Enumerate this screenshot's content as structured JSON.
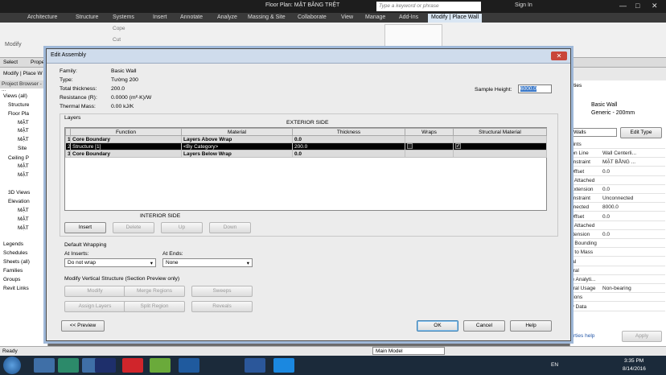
{
  "titlebar": {
    "document": "Floor Plan: MẶT BẰNG TRỆT",
    "search_placeholder": "Type a keyword or phrase",
    "sign_in": "Sign In"
  },
  "ribbon_tabs": [
    "Architecture",
    "Structure",
    "Systems",
    "Insert",
    "Annotate",
    "Analyze",
    "Massing & Site",
    "Collaborate",
    "View",
    "Manage",
    "Add-Ins",
    "Modify | Place Wall"
  ],
  "ribbon": {
    "modify": "Modify",
    "select": "Select",
    "properties": "Prope",
    "cope": "Cope",
    "cut": "Cut",
    "context": "Modify | Place W"
  },
  "project_browser": {
    "title": "Project Browser - ...",
    "items": [
      "Views (all)",
      "Structure",
      "Floor Pla",
      "MẶT",
      "MẶT",
      "MẶT",
      "Site",
      "Ceiling P",
      "MẶT",
      "MẶT",
      "3D Views",
      "Elevation",
      "MẶT",
      "MẶT",
      "MẶT",
      "Legends",
      "Schedules",
      "Sheets (all)",
      "Families",
      "Groups",
      "Revit Links"
    ]
  },
  "properties": {
    "header": "rties",
    "type_name": "Basic Wall",
    "type_sub": "Generic - 200mm",
    "walls": "Walls",
    "edit_type": "Edit Type",
    "rows": [
      {
        "k": "aints",
        "v": ""
      },
      {
        "k": "ion Line",
        "v": "Wall Centerli..."
      },
      {
        "k": "onstraint",
        "v": "MẶT BẰNG ..."
      },
      {
        "k": "Offset",
        "v": "0.0"
      },
      {
        "k": "s Attached",
        "v": ""
      },
      {
        "k": "Extension",
        "v": "0.0"
      },
      {
        "k": "onstraint",
        "v": "Unconnected"
      },
      {
        "k": "nnected",
        "v": "8000.0"
      },
      {
        "k": "Offset",
        "v": "0.0"
      },
      {
        "k": "s Attached",
        "v": ""
      },
      {
        "k": "xtension",
        "v": "0.0"
      },
      {
        "k": "n Bounding",
        "v": ""
      },
      {
        "k": "d to Mass",
        "v": ""
      },
      {
        "k": "ral",
        "v": ""
      },
      {
        "k": "ural",
        "v": ""
      },
      {
        "k": "le Analyti...",
        "v": ""
      },
      {
        "k": "ural Usage",
        "v": "Non-bearing"
      },
      {
        "k": "sions",
        "v": ""
      },
      {
        "k": "ly Data",
        "v": ""
      }
    ],
    "help": "rties help",
    "apply": "Apply"
  },
  "status": {
    "left": "Ready",
    "model": "Main Model"
  },
  "taskbar": {
    "lang": "EN",
    "time": "3:35 PM",
    "date": "8/14/2016"
  },
  "dialog": {
    "title": "Edit Assembly",
    "family_label": "Family:",
    "family": "Basic Wall",
    "type_label": "Type:",
    "type": "Tường 200",
    "thickness_label": "Total thickness:",
    "thickness": "200.0",
    "resistance_label": "Resistance (R):",
    "resistance": "0.0000 (m²·K)/W",
    "mass_label": "Thermal Mass:",
    "mass": "0.00 kJ/K",
    "sample_label": "Sample Height:",
    "sample": "6000.0",
    "layers_label": "Layers",
    "exterior": "EXTERIOR SIDE",
    "interior": "INTERIOR SIDE",
    "cols": [
      "Function",
      "Material",
      "Thickness",
      "Wraps",
      "Structural Material"
    ],
    "rows": [
      {
        "n": "1",
        "f": "Core Boundary",
        "m": "Layers Above Wrap",
        "t": "0.0"
      },
      {
        "n": "2",
        "f": "Structure [1]",
        "m": "<By Category>",
        "t": "200.0"
      },
      {
        "n": "3",
        "f": "Core Boundary",
        "m": "Layers Below Wrap",
        "t": "0.0"
      }
    ],
    "btn_insert": "Insert",
    "btn_delete": "Delete",
    "btn_up": "Up",
    "btn_down": "Down",
    "wrapping": "Default Wrapping",
    "at_inserts": "At Inserts:",
    "at_inserts_val": "Do not wrap",
    "at_ends": "At Ends:",
    "at_ends_val": "None",
    "vertical": "Modify Vertical Structure (Section Preview only)",
    "v_btns": [
      "Modify",
      "Merge Regions",
      "Sweeps",
      "Assign Layers",
      "Split Region",
      "Reveals"
    ],
    "preview": "<< Preview",
    "ok": "OK",
    "cancel": "Cancel",
    "help": "Help"
  }
}
